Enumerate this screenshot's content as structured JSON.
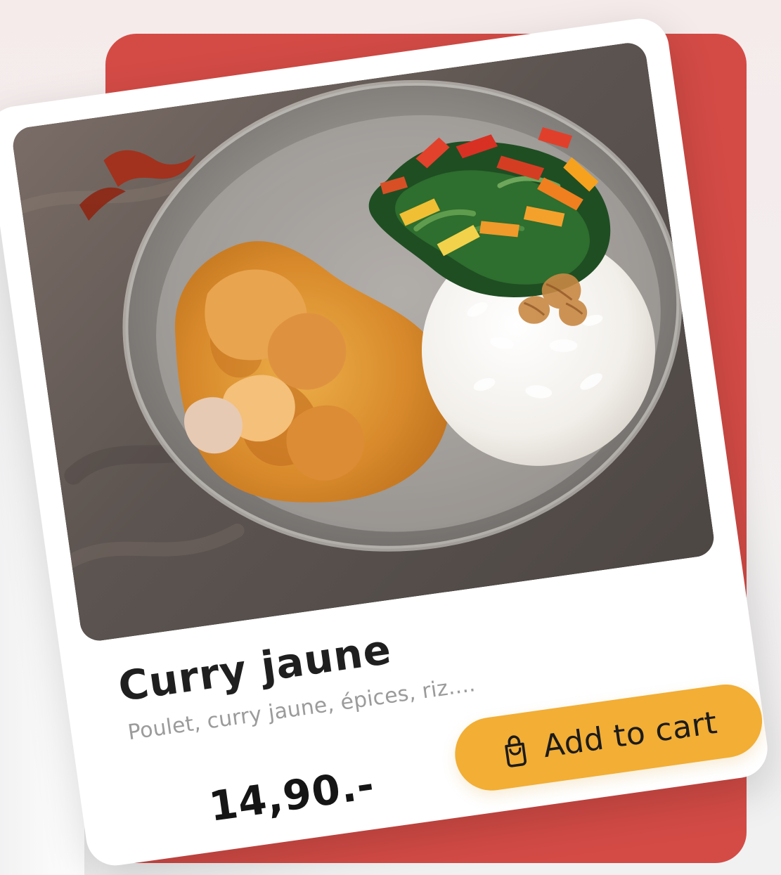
{
  "product": {
    "title": "Curry jaune",
    "description": "Poulet, curry jaune, épices, riz....",
    "price": "14,90.-",
    "button_label": "Add to cart",
    "button_icon": "shopping-bag-icon",
    "image_subject": "curry-rice-bowl"
  },
  "colors": {
    "background": "#f5efef",
    "accent_red": "#d44b46",
    "button_yellow": "#f2ae35",
    "title_text": "#1f1f1f",
    "subtitle_text": "#9b9b9b"
  }
}
